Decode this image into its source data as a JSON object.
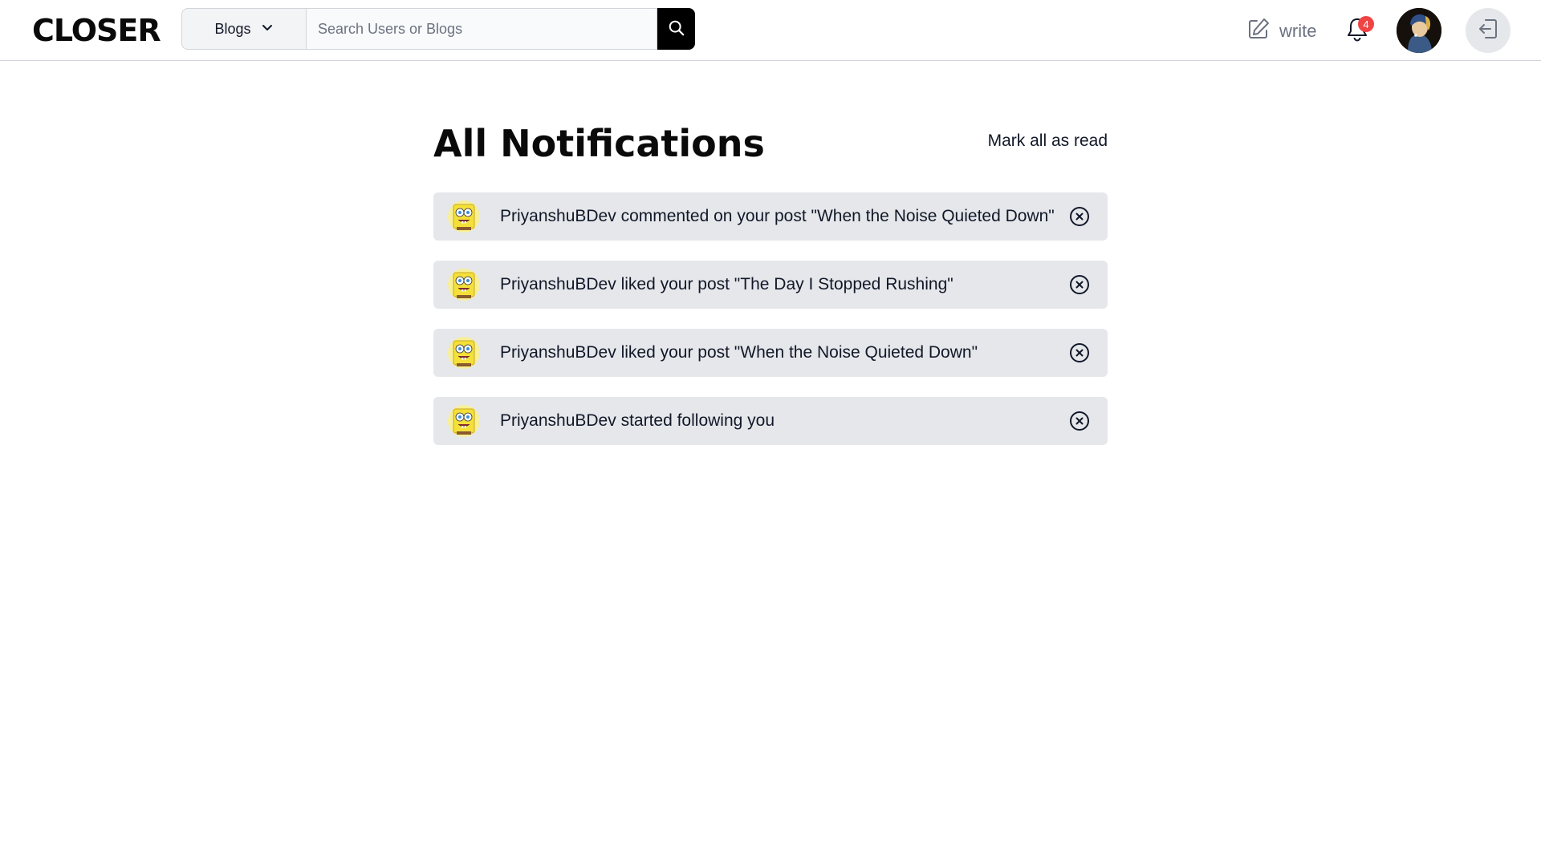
{
  "header": {
    "logo": "CLOSER",
    "category": {
      "selected": "Blogs"
    },
    "search": {
      "placeholder": "Search Users or Blogs",
      "value": ""
    },
    "write_label": "write",
    "notification_count": "4"
  },
  "icons": {
    "chevron": "chevron-down-icon",
    "search": "search-icon",
    "write": "pencil-square-icon",
    "bell": "bell-icon",
    "logout": "logout-icon",
    "close": "x-circle-icon"
  },
  "main": {
    "title": "All Notifications",
    "mark_all_label": "Mark all as read",
    "notifications": [
      {
        "text": "PriyanshuBDev commented on your post \"When the Noise Quieted Down\""
      },
      {
        "text": "PriyanshuBDev liked your post \"The Day I Stopped Rushing\""
      },
      {
        "text": "PriyanshuBDev liked your post \"When the Noise Quieted Down\""
      },
      {
        "text": "PriyanshuBDev started following you"
      }
    ]
  },
  "colors": {
    "badge": "#ef4444",
    "notification_bg": "#e5e7eb",
    "search_button": "#000000"
  }
}
